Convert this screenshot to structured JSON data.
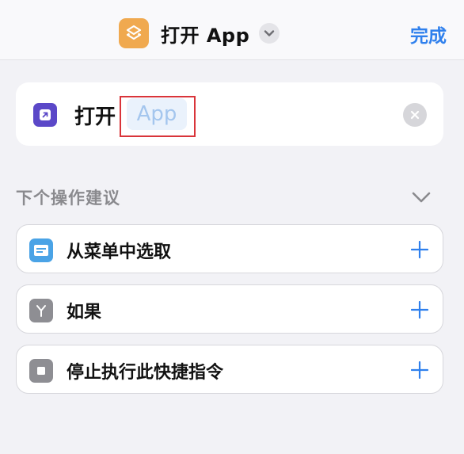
{
  "header": {
    "title": "打开 App",
    "done_label": "完成",
    "icon": "shortcuts-icon",
    "accent_color": "#2f80ed",
    "icon_color": "#f0a94f"
  },
  "action": {
    "label": "打开",
    "parameter_placeholder": "App",
    "icon": "open-app-icon",
    "icon_color": "#5b48c8"
  },
  "suggestions": {
    "header": "下个操作建议",
    "items": [
      {
        "label": "从菜单中选取",
        "icon": "choose-from-menu-icon",
        "color": "#4aa3e6"
      },
      {
        "label": "如果",
        "icon": "if-branch-icon",
        "color": "#8e8e93"
      },
      {
        "label": "停止执行此快捷指令",
        "icon": "stop-icon",
        "color": "#8e8e93"
      }
    ]
  }
}
